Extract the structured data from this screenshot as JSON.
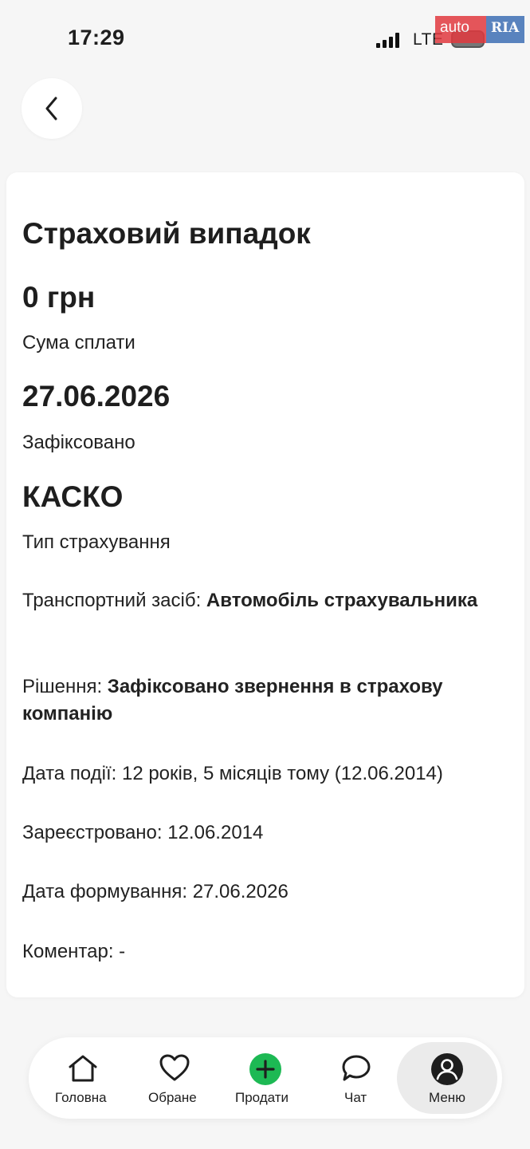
{
  "status_bar": {
    "time": "17:29",
    "network": "LTE"
  },
  "watermark": {
    "auto": "auto",
    "ria": "RIA"
  },
  "card": {
    "title": "Страховий випадок",
    "amount_value": "0 грн",
    "amount_label": "Сума сплати",
    "date_value": "27.06.2026",
    "date_label": "Зафіксовано",
    "type_value": "КАСКО",
    "type_label": "Тип страхування",
    "vehicle_label": "Транспортний засіб:",
    "vehicle_value": "Автомобіль страхувальника",
    "decision_label": "Рішення:",
    "decision_value": "Зафіксовано звернення в страхову компанію",
    "event_date": "Дата події: 12 років, 5 місяців тому (12.06.2014)",
    "registered": "Зареєстровано: 12.06.2014",
    "formed": "Дата формування: 27.06.2026",
    "comment": "Коментар: -"
  },
  "bottom_nav": {
    "items": [
      {
        "label": "Головна",
        "icon": "home-icon"
      },
      {
        "label": "Обране",
        "icon": "heart-icon"
      },
      {
        "label": "Продати",
        "icon": "plus-circle-icon"
      },
      {
        "label": "Чат",
        "icon": "chat-icon"
      },
      {
        "label": "Меню",
        "icon": "user-icon",
        "active": true
      }
    ]
  },
  "colors": {
    "accent_green": "#1db954",
    "card_bg": "#ffffff",
    "page_bg": "#f6f6f6"
  }
}
